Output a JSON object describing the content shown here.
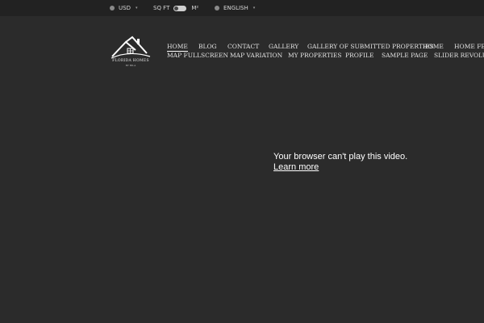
{
  "topbar": {
    "currency": "USD",
    "unit_left": "SQ FT",
    "unit_right": "M²",
    "language": "ENGLISH",
    "caret": "▾"
  },
  "logo": {
    "name": "FLORIDA HOMES",
    "sub": "BY BILA"
  },
  "nav": {
    "row1": [
      "HOME",
      "BLOG",
      "CONTACT",
      "GALLERY",
      "GALLERY OF SUBMITTED PROPERTIES",
      "HOME",
      "HOME FEED"
    ],
    "row2": [
      "MAP FULLSCREEN",
      "MAP VARIATION",
      "MY PROPERTIES",
      "PROFILE",
      "SAMPLE PAGE",
      "SLIDER REVOLUTION"
    ]
  },
  "video": {
    "message": "Your browser can't play this video.",
    "link": "Learn more"
  },
  "colors": {
    "background": "#2b2b2b",
    "topbar": "#222222",
    "text": "#ffffff"
  }
}
